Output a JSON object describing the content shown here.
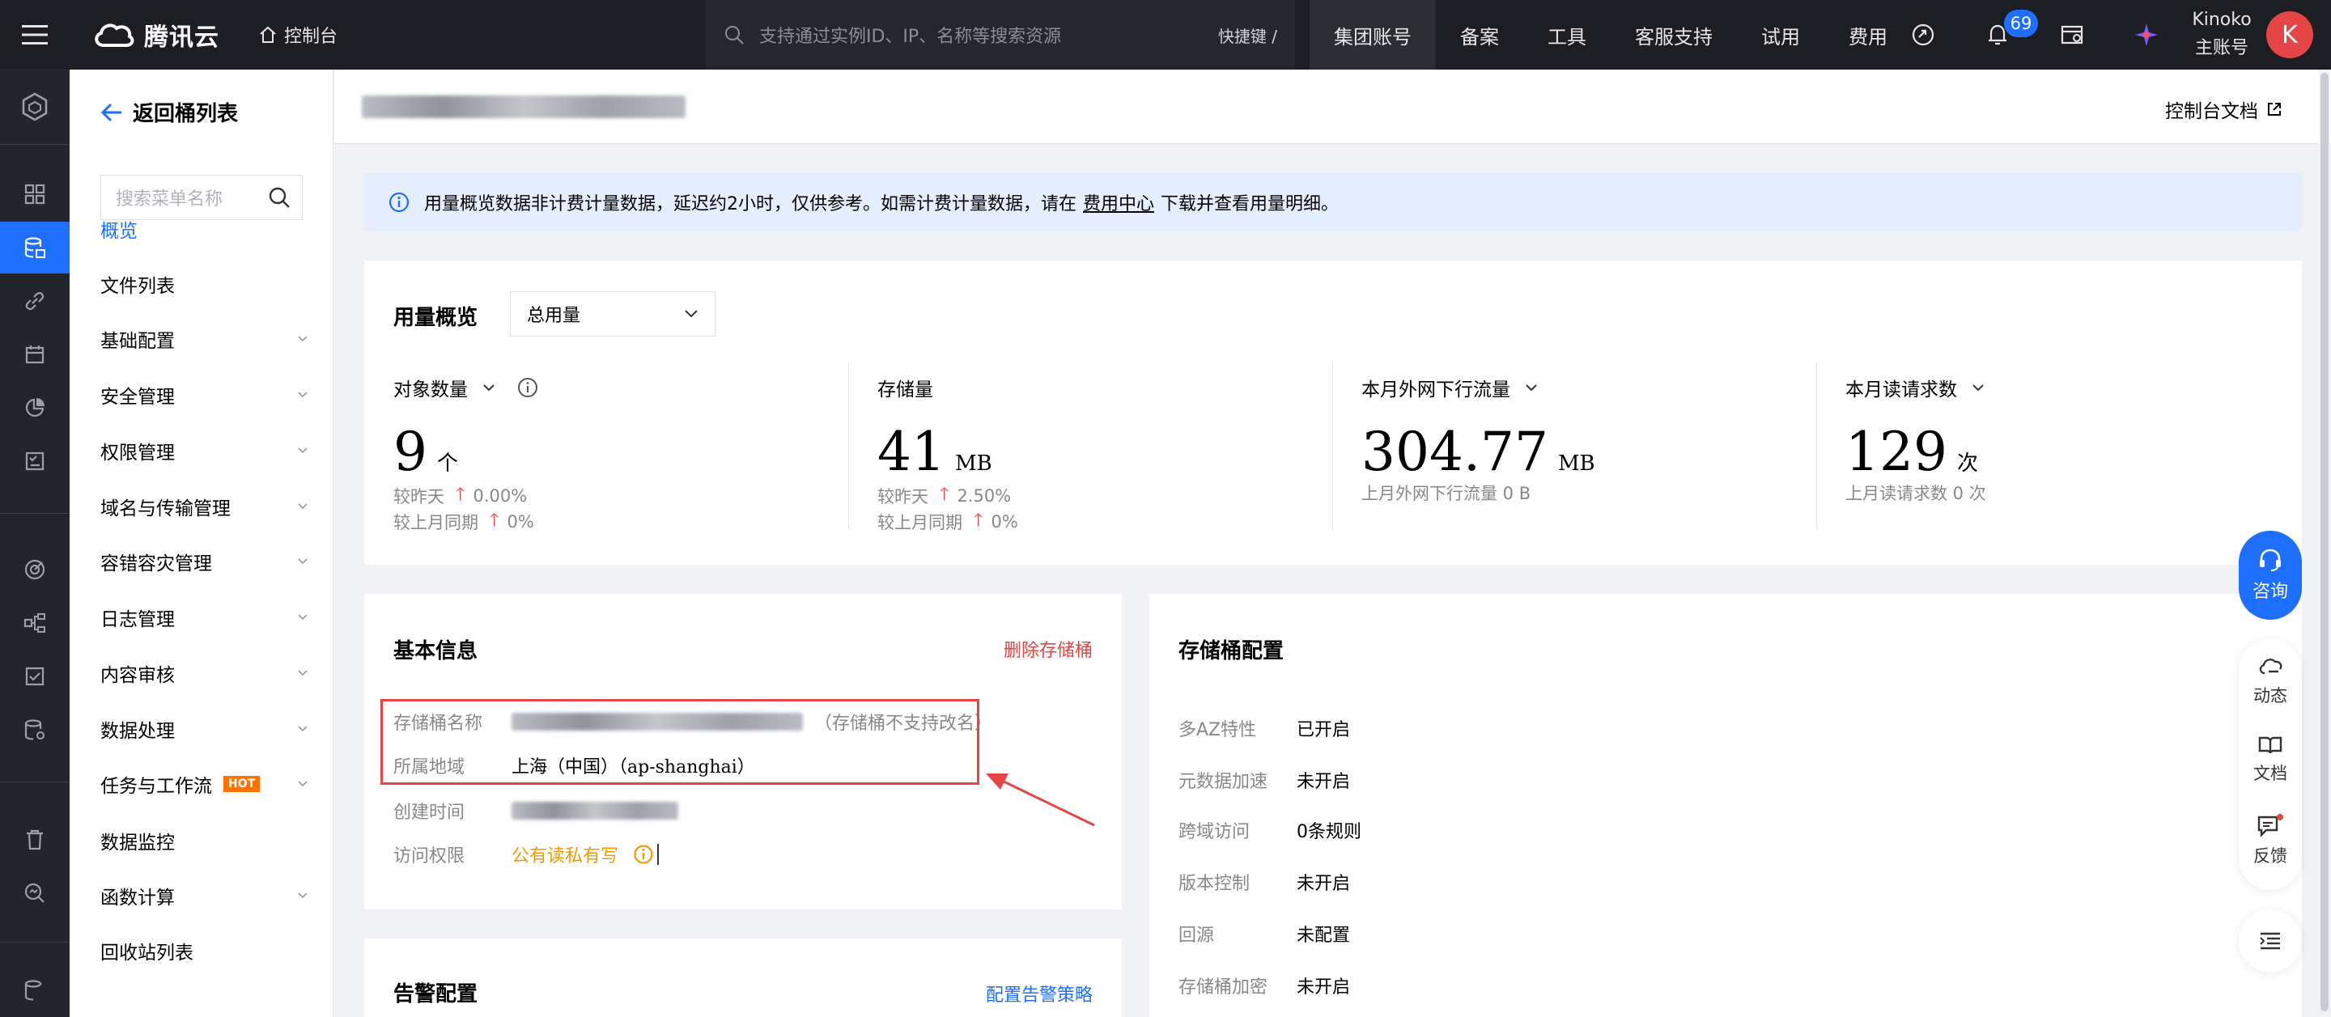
{
  "topbar": {
    "brand": "腾讯云",
    "console_label": "控制台",
    "search_placeholder": "支持通过实例ID、IP、名称等搜索资源",
    "shortcut_label": "快捷键 /",
    "nav": [
      "集团账号",
      "备案",
      "工具",
      "客服支持",
      "试用",
      "费用"
    ],
    "notification_count": "69",
    "account_name": "Kinoko",
    "account_role": "主账号",
    "avatar_letter": "K"
  },
  "menu": {
    "back_label": "返回桶列表",
    "search_placeholder": "搜索菜单名称",
    "items": [
      {
        "label": "概览",
        "active": true,
        "expandable": false
      },
      {
        "label": "文件列表",
        "expandable": false
      },
      {
        "label": "基础配置",
        "expandable": true
      },
      {
        "label": "安全管理",
        "expandable": true
      },
      {
        "label": "权限管理",
        "expandable": true
      },
      {
        "label": "域名与传输管理",
        "expandable": true
      },
      {
        "label": "容错容灾管理",
        "expandable": true
      },
      {
        "label": "日志管理",
        "expandable": true
      },
      {
        "label": "内容审核",
        "expandable": true
      },
      {
        "label": "数据处理",
        "expandable": true
      },
      {
        "label": "任务与工作流",
        "badge": "HOT",
        "expandable": true
      },
      {
        "label": "数据监控",
        "expandable": false
      },
      {
        "label": "函数计算",
        "expandable": true
      },
      {
        "label": "回收站列表",
        "expandable": false
      }
    ]
  },
  "page": {
    "doc_link": "控制台文档",
    "notice_prefix": "用量概览数据非计费计量数据，延迟约2小时，仅供参考。如需计费计量数据，请在",
    "notice_link": "费用中心",
    "notice_suffix": "下载并查看用量明细。"
  },
  "usage": {
    "title": "用量概览",
    "select_value": "总用量",
    "stats": [
      {
        "label": "对象数量",
        "value": "9",
        "unit": "个",
        "cmp1_label": "较昨天",
        "cmp1_value": "0.00%",
        "cmp2_label": "较上月同期",
        "cmp2_value": "0%"
      },
      {
        "label": "存储量",
        "value": "41",
        "unit": "MB",
        "cmp1_label": "较昨天",
        "cmp1_value": "2.50%",
        "cmp2_label": "较上月同期",
        "cmp2_value": "0%"
      },
      {
        "label": "本月外网下行流量",
        "value": "304.77",
        "unit": "MB",
        "sub": "上月外网下行流量 0 B"
      },
      {
        "label": "本月读请求数",
        "value": "129",
        "unit": "次",
        "sub": "上月读请求数 0 次"
      }
    ]
  },
  "basic": {
    "title": "基本信息",
    "delete_label": "删除存储桶",
    "rows": [
      {
        "key": "存储桶名称",
        "note": "（存储桶不支持改名）"
      },
      {
        "key": "所属地域",
        "value": "上海（中国）（ap-shanghai）"
      },
      {
        "key": "创建时间"
      },
      {
        "key": "访问权限",
        "value": "公有读私有写"
      }
    ]
  },
  "alert": {
    "title": "告警配置",
    "action_label": "配置告警策略"
  },
  "config": {
    "title": "存储桶配置",
    "rows": [
      {
        "key": "多AZ特性",
        "value": "已开启"
      },
      {
        "key": "元数据加速",
        "value": "未开启"
      },
      {
        "key": "跨域访问",
        "value": "0条规则"
      },
      {
        "key": "版本控制",
        "value": "未开启"
      },
      {
        "key": "回源",
        "value": "未配置"
      },
      {
        "key": "存储桶加密",
        "value": "未开启"
      }
    ]
  },
  "dock": {
    "consult": "咨询",
    "dynamic": "动态",
    "docs": "文档",
    "feedback": "反馈"
  },
  "colors": {
    "accent": "#1e6fff",
    "danger": "#e54545",
    "warning": "#f29a00",
    "topbar": "#1c1e24"
  }
}
